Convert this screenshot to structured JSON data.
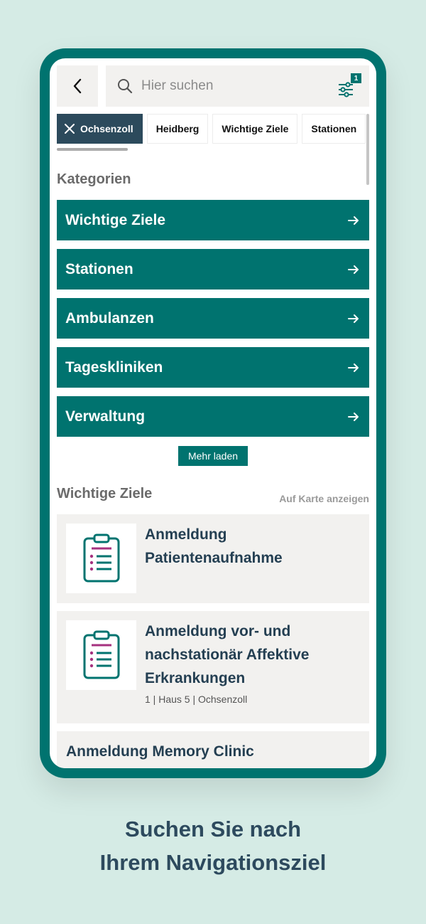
{
  "search": {
    "placeholder": "Hier suchen",
    "filter_count": "1"
  },
  "chips": [
    {
      "label": "Ochsenzoll",
      "active": true
    },
    {
      "label": "Heidberg",
      "active": false
    },
    {
      "label": "Wichtige Ziele",
      "active": false
    },
    {
      "label": "Stationen",
      "active": false
    }
  ],
  "categories": {
    "title": "Kategorien",
    "items": [
      "Wichtige Ziele",
      "Stationen",
      "Ambulanzen",
      "Tageskliniken",
      "Verwaltung"
    ],
    "more_label": "Mehr laden"
  },
  "important": {
    "title": "Wichtige Ziele",
    "map_link": "Auf Karte anzeigen",
    "items": [
      {
        "title": "Anmeldung Patientenaufnahme",
        "meta": ""
      },
      {
        "title": "Anmeldung vor- und nachstationär Affektive Erkrankungen",
        "meta": "1 | Haus 5 | Ochsenzoll"
      },
      {
        "title": "Anmeldung Memory Clinic",
        "meta": ""
      }
    ]
  },
  "caption": {
    "line1": "Suchen Sie nach",
    "line2": "Ihrem Navigationsziel"
  },
  "colors": {
    "teal": "#00736f",
    "navy": "#2c4a5c",
    "background": "#d5ebe5"
  },
  "icons": [
    "back-arrow-icon",
    "search-icon",
    "filter-sliders-icon",
    "close-icon",
    "arrow-right-icon",
    "clipboard-list-icon"
  ]
}
